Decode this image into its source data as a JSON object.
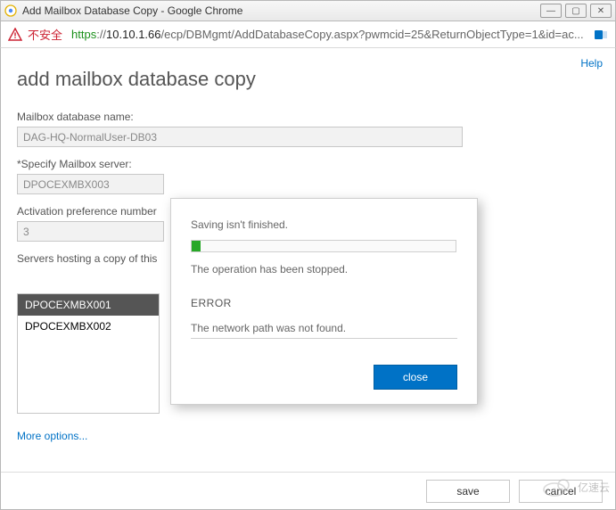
{
  "window": {
    "title": "Add Mailbox Database Copy - Google Chrome"
  },
  "win_controls": {
    "min": "—",
    "max": "▢",
    "close": "✕"
  },
  "address": {
    "insecure_label": "不安全",
    "scheme": "https",
    "host": "10.10.1.66",
    "path": "/ecp/DBMgmt/AddDatabaseCopy.aspx?pwmcid=25&ReturnObjectType=1&id=ac..."
  },
  "help_link": "Help",
  "page_title": "add mailbox database copy",
  "fields": {
    "db_name_label": "Mailbox database name:",
    "db_name_value": "DAG-HQ-NormalUser-DB03",
    "server_label": "*Specify Mailbox server:",
    "server_value": "DPOCEXMBX003",
    "pref_label": "Activation preference number",
    "pref_value": "3",
    "list_label": "Servers hosting a copy of this",
    "list_items": [
      "DPOCEXMBX001",
      "DPOCEXMBX002"
    ]
  },
  "more_options": "More options...",
  "footer": {
    "save": "save",
    "cancel": "cancel"
  },
  "modal": {
    "saving_msg": "Saving isn't finished.",
    "stopped_msg": "The operation has been stopped.",
    "error_heading": "ERROR",
    "error_msg": "The network path was not found.",
    "close": "close"
  },
  "watermark": "亿速云"
}
